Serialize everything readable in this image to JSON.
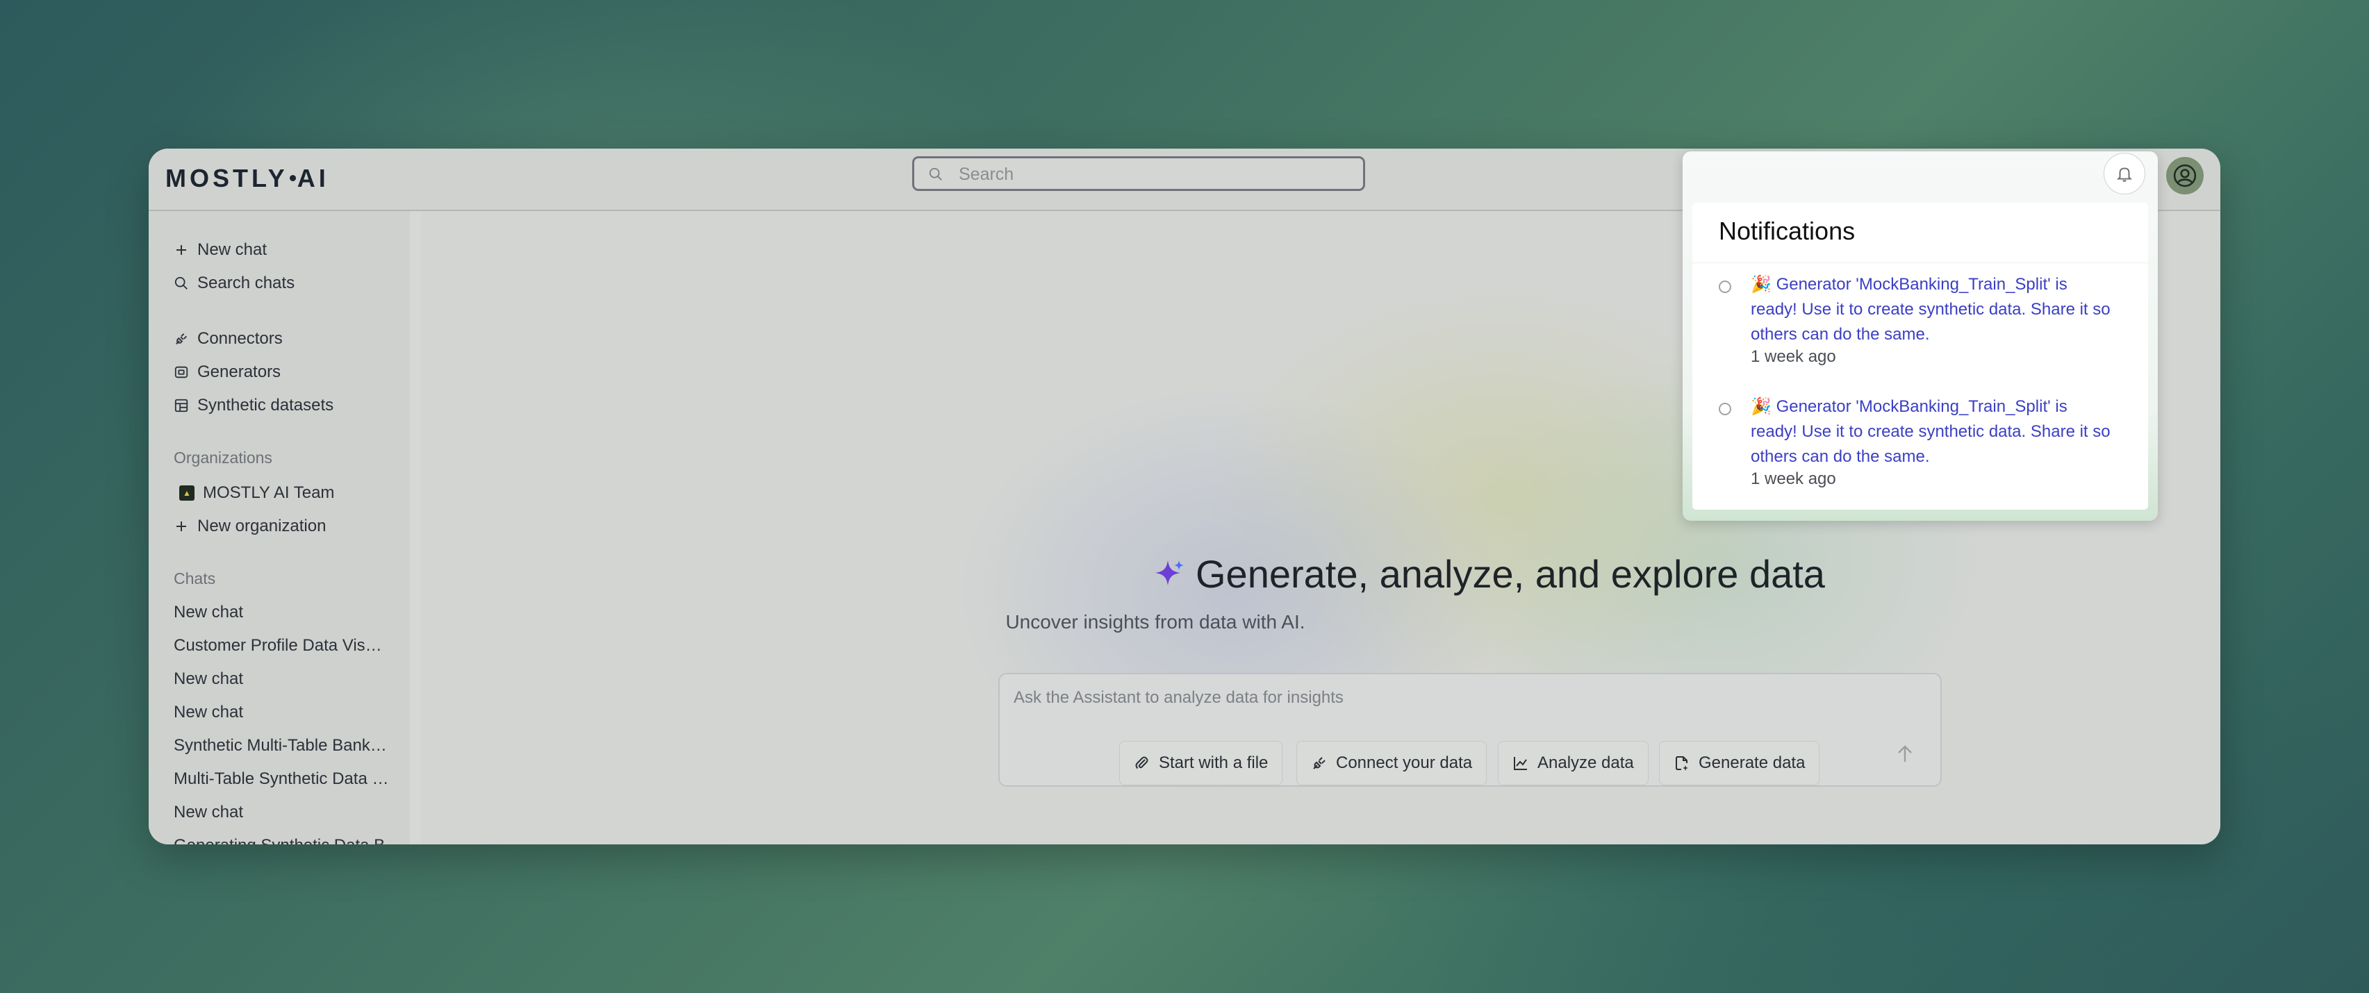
{
  "app": {
    "logo_text_1": "MOSTLY",
    "logo_text_2": "AI"
  },
  "search": {
    "placeholder": "Search"
  },
  "sidebar": {
    "actions": [
      {
        "label": "New chat",
        "icon": "plus-icon"
      },
      {
        "label": "Search chats",
        "icon": "search-icon"
      }
    ],
    "nav": [
      {
        "label": "Connectors",
        "icon": "plug-icon"
      },
      {
        "label": "Generators",
        "icon": "generator-icon"
      },
      {
        "label": "Synthetic datasets",
        "icon": "table-icon"
      }
    ],
    "organizations_label": "Organizations",
    "organizations": [
      {
        "label": "MOSTLY AI Team",
        "icon": "org-logo-icon"
      }
    ],
    "new_organization_label": "New organization",
    "chats_label": "Chats",
    "chats": [
      "New chat",
      "Customer Profile Data Visualization",
      "New chat",
      "New chat",
      "Synthetic Multi-Table Banking",
      "Multi-Table Synthetic Data Generation",
      "New chat",
      "Generating Synthetic Data B"
    ]
  },
  "main": {
    "headline": "Generate, analyze, and explore data",
    "subline": "Uncover insights from data with AI.",
    "prompt_placeholder": "Ask the Assistant to analyze data for insights",
    "actions": [
      {
        "label": "Start with a file",
        "icon": "paperclip-icon"
      },
      {
        "label": "Connect your data",
        "icon": "plug-icon"
      },
      {
        "label": "Analyze data",
        "icon": "chart-icon"
      },
      {
        "label": "Generate data",
        "icon": "file-generate-icon"
      }
    ]
  },
  "notifications": {
    "title": "Notifications",
    "items": [
      {
        "emoji": "🎉",
        "text": "Generator 'MockBanking_Train_Split' is ready! Use it to create synthetic data. Share it so others can do the same.",
        "time": "1 week ago"
      },
      {
        "emoji": "🎉",
        "text": "Generator 'MockBanking_Train_Split' is ready! Use it to create synthetic data. Share it so others can do the same.",
        "time": "1 week ago"
      }
    ]
  },
  "colors": {
    "link": "#3b3fc4",
    "accent_sparkle": "#6c3fd6"
  }
}
